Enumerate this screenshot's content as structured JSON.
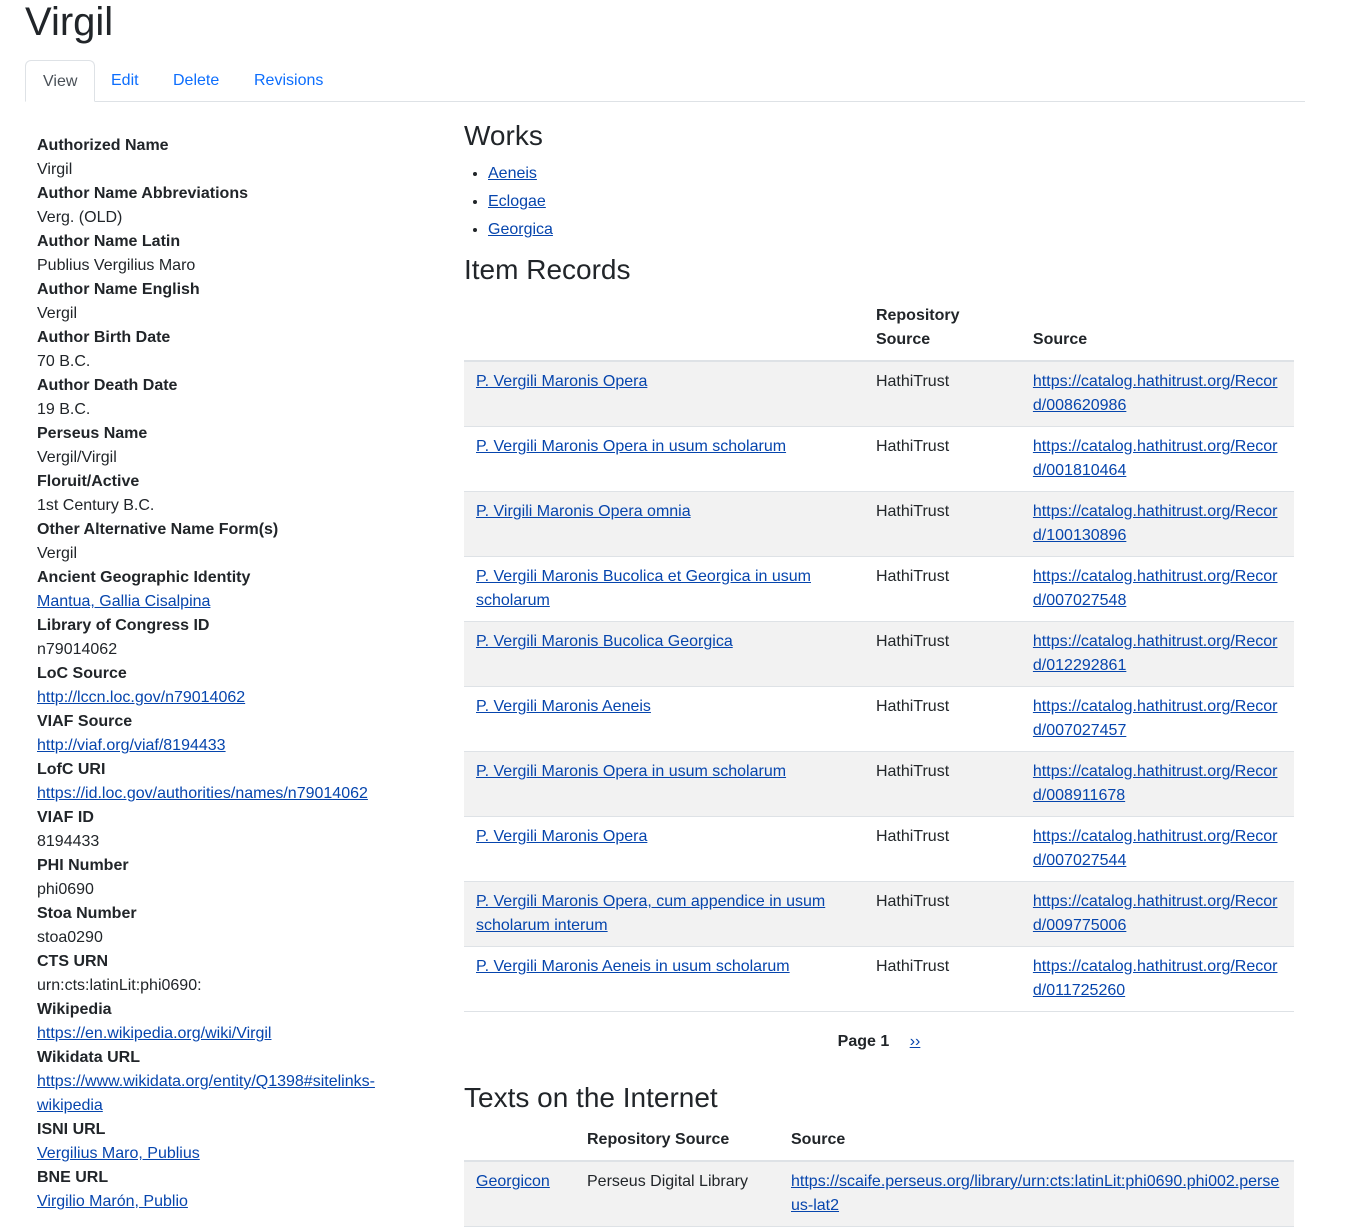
{
  "title": "Virgil",
  "tabs": [
    {
      "label": "View"
    },
    {
      "label": "Edit"
    },
    {
      "label": "Delete"
    },
    {
      "label": "Revisions"
    }
  ],
  "fields": [
    {
      "label": "Authorized Name",
      "value": "Virgil"
    },
    {
      "label": "Author Name Abbreviations",
      "value": "Verg. (OLD)"
    },
    {
      "label": "Author Name Latin",
      "value": "Publius Vergilius Maro"
    },
    {
      "label": "Author Name English",
      "value": "Vergil"
    },
    {
      "label": "Author Birth Date",
      "value": "70 B.C."
    },
    {
      "label": "Author Death Date",
      "value": "19 B.C."
    },
    {
      "label": "Perseus Name",
      "value": "Vergil/Virgil"
    },
    {
      "label": "Floruit/Active",
      "value": "1st Century B.C."
    },
    {
      "label": "Other Alternative Name Form(s)",
      "value": "Vergil"
    },
    {
      "label": "Ancient Geographic Identity",
      "value": "Mantua, Gallia Cisalpina"
    },
    {
      "label": "Library of Congress ID",
      "value": "n79014062"
    },
    {
      "label": "LoC Source",
      "value": "http://lccn.loc.gov/n79014062"
    },
    {
      "label": "VIAF Source",
      "value": "http://viaf.org/viaf/8194433"
    },
    {
      "label": "LofC URI",
      "value": "https://id.loc.gov/authorities/names/n79014062"
    },
    {
      "label": "VIAF ID",
      "value": "8194433"
    },
    {
      "label": "PHI Number",
      "value": "phi0690"
    },
    {
      "label": "Stoa Number",
      "value": "stoa0290"
    },
    {
      "label": "CTS URN",
      "value": "urn:cts:latinLit:phi0690:"
    },
    {
      "label": "Wikipedia",
      "value": "https://en.wikipedia.org/wiki/Virgil"
    },
    {
      "label": "Wikidata URL",
      "value": "https://www.wikidata.org/entity/Q1398#sitelinks-wikipedia"
    },
    {
      "label": "ISNI URL",
      "value": "Vergilius Maro, Publius"
    },
    {
      "label": "BNE URL",
      "value": "Virgilio Marón, Publio"
    }
  ],
  "works": {
    "heading": "Works",
    "items": [
      "Aeneis",
      "Eclogae",
      "Georgica"
    ]
  },
  "item_records": {
    "heading": "Item Records",
    "headers": [
      "",
      "Repository Source",
      "Source"
    ],
    "rows": [
      {
        "title": "P. Vergili Maronis Opera",
        "repo": "HathiTrust",
        "url": "https://catalog.hathitrust.org/Record/008620986"
      },
      {
        "title": "P. Vergili Maronis Opera in usum scholarum",
        "repo": "HathiTrust",
        "url": "https://catalog.hathitrust.org/Record/001810464"
      },
      {
        "title": "P. Virgili Maronis Opera omnia",
        "repo": "HathiTrust",
        "url": "https://catalog.hathitrust.org/Record/100130896"
      },
      {
        "title": "P. Vergili Maronis Bucolica et Georgica in usum scholarum",
        "repo": "HathiTrust",
        "url": "https://catalog.hathitrust.org/Record/007027548"
      },
      {
        "title": "P. Vergili Maronis Bucolica Georgica",
        "repo": "HathiTrust",
        "url": "https://catalog.hathitrust.org/Record/012292861"
      },
      {
        "title": "P. Vergili Maronis Aeneis",
        "repo": "HathiTrust",
        "url": "https://catalog.hathitrust.org/Record/007027457"
      },
      {
        "title": "P. Vergili Maronis Opera in usum scholarum",
        "repo": "HathiTrust",
        "url": "https://catalog.hathitrust.org/Record/008911678"
      },
      {
        "title": "P. Vergili Maronis Opera",
        "repo": "HathiTrust",
        "url": "https://catalog.hathitrust.org/Record/007027544"
      },
      {
        "title": "P. Vergili Maronis Opera, cum appendice in usum scholarum interum",
        "repo": "HathiTrust",
        "url": "https://catalog.hathitrust.org/Record/009775006"
      },
      {
        "title": "P. Vergili Maronis Aeneis in usum scholarum",
        "repo": "HathiTrust",
        "url": "https://catalog.hathitrust.org/Record/011725260"
      }
    ],
    "pager": {
      "current": "Page 1",
      "next": "››"
    }
  },
  "texts": {
    "heading": "Texts on the Internet",
    "headers": [
      "",
      "Repository Source",
      "Source"
    ],
    "rows": [
      {
        "title": "Georgicon",
        "repo": "Perseus Digital Library",
        "url": "https://scaife.perseus.org/library/urn:cts:latinLit:phi0690.phi002.perseus-lat2"
      }
    ]
  }
}
